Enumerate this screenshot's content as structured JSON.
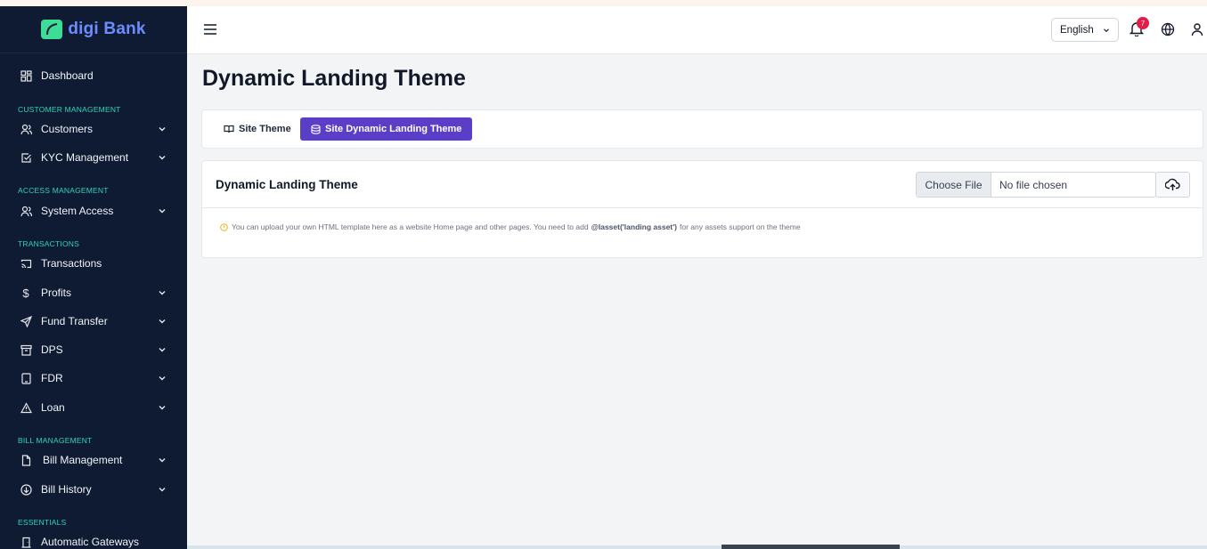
{
  "brand": {
    "name": "digi Bank",
    "logo_icon": "leaf-icon",
    "accent": "#6d8cff",
    "logo_color": "#3ddc97"
  },
  "sidebar": {
    "dashboard": "Dashboard",
    "sections": {
      "customer": "CUSTOMER MANAGEMENT",
      "access": "ACCESS MANAGEMENT",
      "transactions": "TRANSACTIONS",
      "bill": "BILL MANAGEMENT",
      "essentials": "ESSENTIALS"
    },
    "items": {
      "customers": "Customers",
      "kyc": "KYC Management",
      "system_access": "System Access",
      "transactions": "Transactions",
      "profits": "Profits",
      "fund_transfer": "Fund Transfer",
      "dps": "DPS",
      "fdr": "FDR",
      "loan": "Loan",
      "bill_management": "Bill Management",
      "bill_history": "Bill History",
      "automatic_gateways": "Automatic Gateways"
    }
  },
  "header": {
    "language": "English",
    "notification_count": "7"
  },
  "page": {
    "title": "Dynamic Landing Theme",
    "tabs": {
      "site_theme": "Site Theme",
      "dynamic_theme": "Site Dynamic Landing Theme"
    },
    "card": {
      "title": "Dynamic Landing Theme",
      "choose_file": "Choose File",
      "no_file": "No file chosen",
      "note_before": "You can upload your own HTML template here as a website Home page and other pages. You need to add",
      "note_code": "@lasset('landing asset')",
      "note_after": "for any assets support on the theme"
    }
  },
  "colors": {
    "sidebar_bg": "#0f1b33",
    "section_label": "#2dd4bf",
    "active_tab": "#5b3ec8",
    "badge": "#e11d48"
  }
}
